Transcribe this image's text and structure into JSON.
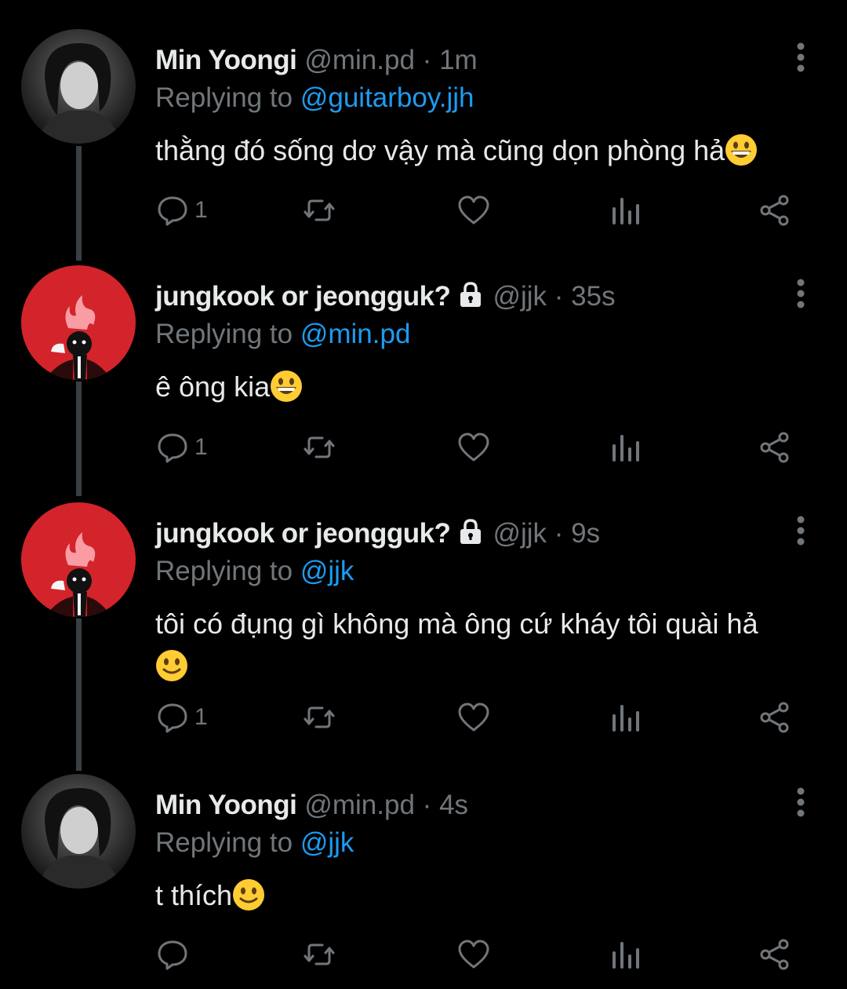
{
  "tweets": [
    {
      "name": "Min Yoongi",
      "handle": "@min.pd",
      "dot": "·",
      "time": "1m",
      "replying_prefix": "Replying to",
      "replying_to": "@guitarboy.jjh",
      "text": "thằng đó sống dơ vậy mà cũng dọn phòng hả",
      "emoji": "grinning-face",
      "protected": false,
      "reply_count": "1",
      "avatar": "yoongi-photo"
    },
    {
      "name": "jungkook or jeongguk?",
      "handle": "@jjk",
      "dot": "·",
      "time": "35s",
      "replying_prefix": "Replying to",
      "replying_to": "@min.pd",
      "text": "ê ông kia",
      "emoji": "grinning-face",
      "protected": true,
      "reply_count": "1",
      "avatar": "red-fire-character"
    },
    {
      "name": "jungkook or jeongguk?",
      "handle": "@jjk",
      "dot": "·",
      "time": "9s",
      "replying_prefix": "Replying to",
      "replying_to": "@jjk",
      "text": "tôi có đụng gì không mà ông cứ kháy tôi quài hả",
      "emoji": "slightly-smiling-face",
      "protected": true,
      "reply_count": "1",
      "avatar": "red-fire-character"
    },
    {
      "name": "Min Yoongi",
      "handle": "@min.pd",
      "dot": "·",
      "time": "4s",
      "replying_prefix": "Replying to",
      "replying_to": "@jjk",
      "text": "t thích",
      "emoji": "slightly-smiling-face",
      "protected": false,
      "reply_count": "",
      "avatar": "yoongi-photo"
    }
  ],
  "icons": [
    "reply-icon",
    "retweet-icon",
    "like-icon",
    "views-icon",
    "share-icon",
    "more-icon",
    "lock-icon"
  ],
  "colors": {
    "background": "#000000",
    "text": "#e7e9ea",
    "muted": "#71767b",
    "link": "#1d9bf0",
    "thread_line": "#3a3f44",
    "avatar_red": "#d3242b"
  }
}
